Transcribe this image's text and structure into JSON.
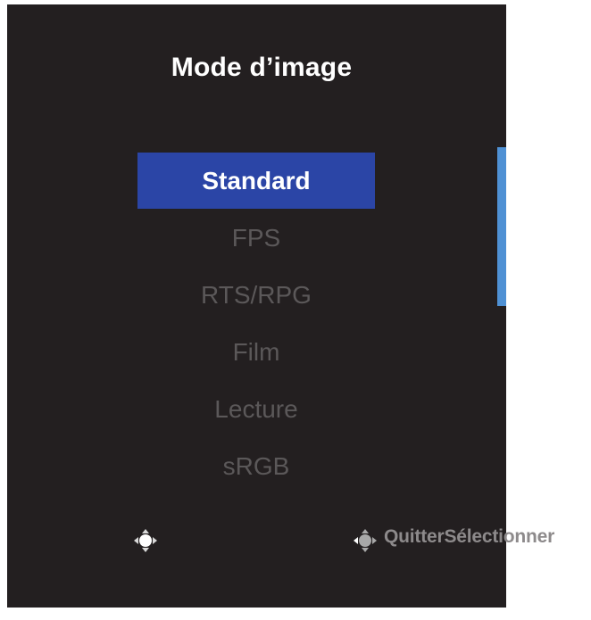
{
  "osd": {
    "title": "Mode d’image",
    "menu_items": [
      {
        "label": "Standard",
        "selected": true
      },
      {
        "label": "FPS",
        "selected": false
      },
      {
        "label": "RTS/RPG",
        "selected": false
      },
      {
        "label": "Film",
        "selected": false
      },
      {
        "label": "Lecture",
        "selected": false
      },
      {
        "label": "sRGB",
        "selected": false
      }
    ],
    "footer": {
      "left_icon": "joystick-press-icon",
      "right_icon": "joystick-press-icon",
      "quit_label": "Quitter",
      "select_label": "Sélectionner"
    },
    "colors": {
      "panel_background": "#231f20",
      "selected_background": "#2b45a6",
      "selected_text": "#ffffff",
      "unselected_text": "#5b5859",
      "scrollbar": "#4f91d4",
      "footer_text": "#8d8a8b"
    }
  }
}
